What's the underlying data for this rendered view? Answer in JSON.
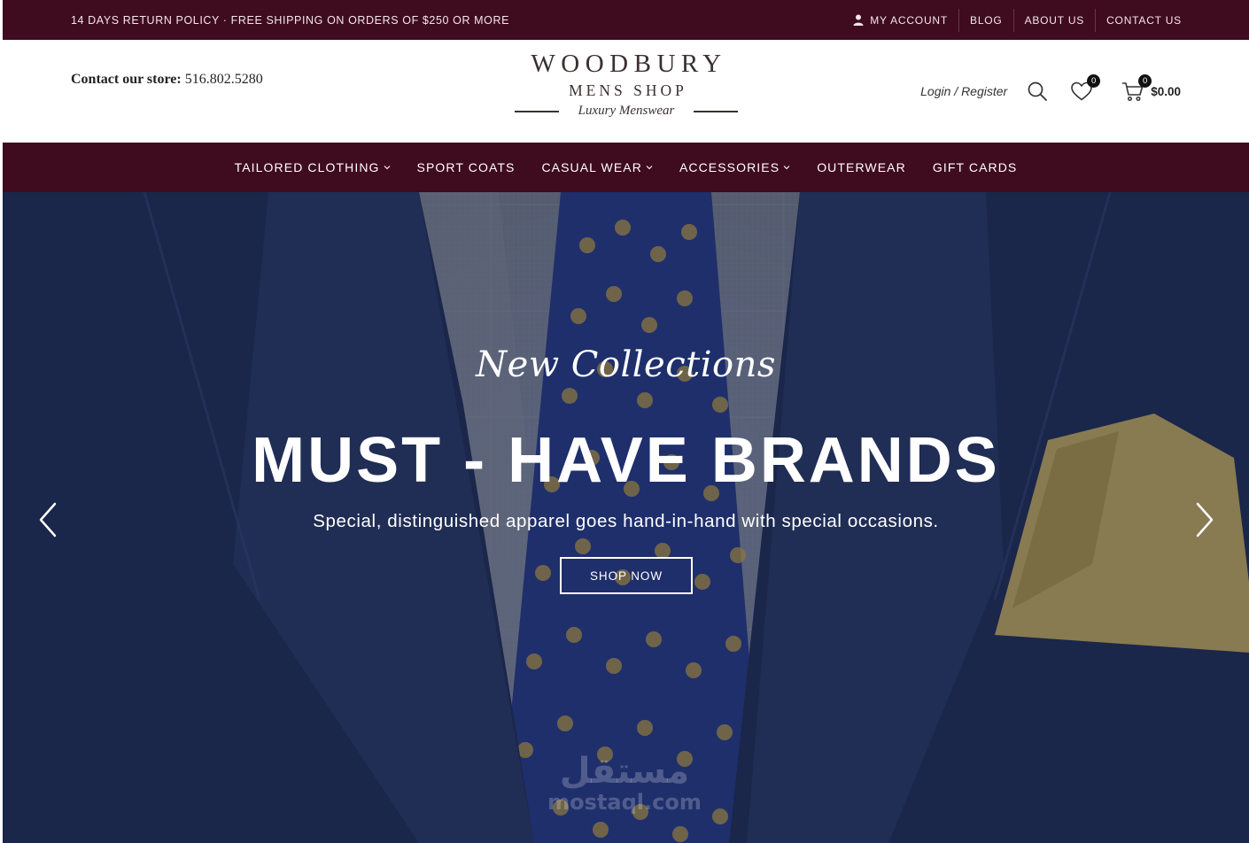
{
  "topbar": {
    "promo": "14 DAYS RETURN POLICY · FREE SHIPPING ON ORDERS OF $250 OR MORE",
    "links": {
      "my_account": "MY ACCOUNT",
      "blog": "BLOG",
      "about_us": "ABOUT US",
      "contact_us": "CONTACT US"
    }
  },
  "header": {
    "contact_label": "Contact our store:",
    "contact_phone": "516.802.5280",
    "logo": {
      "main": "WOODBURY",
      "sub": "MENS SHOP",
      "tagline": "Luxury Menswear"
    },
    "login_register": "Login / Register",
    "wishlist_count": "0",
    "cart_count": "0",
    "cart_total": "$0.00"
  },
  "nav": {
    "items": [
      {
        "label": "TAILORED CLOTHING",
        "has_dropdown": true
      },
      {
        "label": "SPORT COATS",
        "has_dropdown": false
      },
      {
        "label": "CASUAL WEAR",
        "has_dropdown": true
      },
      {
        "label": "ACCESSORIES",
        "has_dropdown": true
      },
      {
        "label": "OUTERWEAR",
        "has_dropdown": false
      },
      {
        "label": "GIFT CARDS",
        "has_dropdown": false
      }
    ]
  },
  "hero": {
    "script_title": "New Collections",
    "heading": "MUST - HAVE BRANDS",
    "subheading": "Special, distinguished apparel goes hand-in-hand with special occasions.",
    "cta_label": "SHOP NOW"
  },
  "watermark": {
    "arabic": "مستقل",
    "latin": "mostaql.com"
  },
  "colors": {
    "brand_maroon": "#3f0b1f",
    "hero_navy": "#1e2c55",
    "text_dark": "#222222",
    "white": "#ffffff"
  },
  "icons": {
    "account": "user-icon",
    "search": "search-icon",
    "wishlist": "heart-icon",
    "cart": "cart-icon",
    "dropdown": "chevron-down-icon",
    "prev": "chevron-left-icon",
    "next": "chevron-right-icon"
  }
}
